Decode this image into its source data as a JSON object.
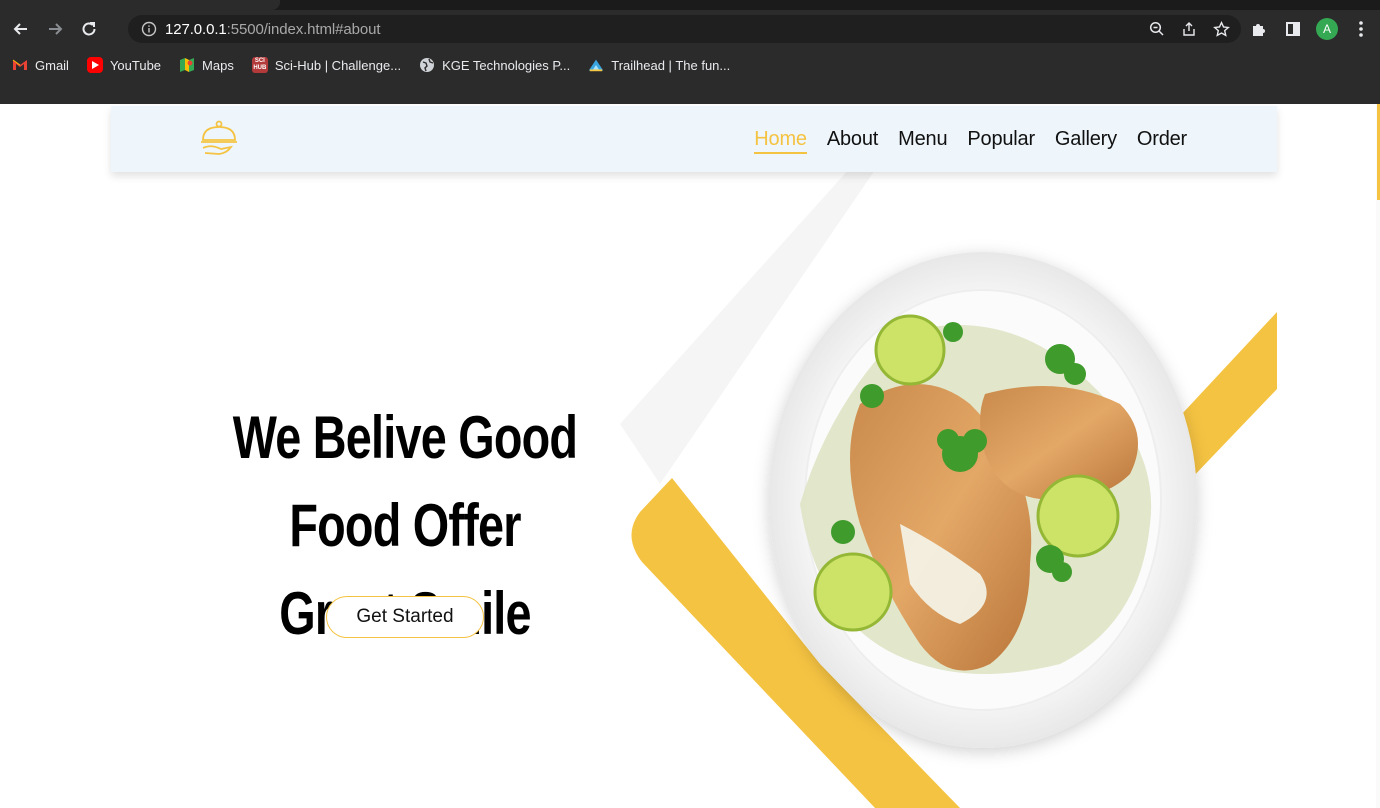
{
  "browser": {
    "url_host": "127.0.0.1",
    "url_rest": ":5500/index.html#about",
    "avatar_letter": "A",
    "bookmarks": [
      {
        "label": "Gmail",
        "icon": "gmail-icon"
      },
      {
        "label": "YouTube",
        "icon": "youtube-icon"
      },
      {
        "label": "Maps",
        "icon": "maps-icon"
      },
      {
        "label": "Sci-Hub | Challenge...",
        "icon": "scihub-icon"
      },
      {
        "label": "KGE Technologies P...",
        "icon": "globe-icon"
      },
      {
        "label": "Trailhead | The fun...",
        "icon": "trailhead-icon"
      }
    ]
  },
  "nav": {
    "items": [
      {
        "label": "Home",
        "active": true
      },
      {
        "label": "About"
      },
      {
        "label": "Menu"
      },
      {
        "label": "Popular"
      },
      {
        "label": "Gallery"
      },
      {
        "label": "Order"
      }
    ]
  },
  "hero": {
    "line1": "We Belive Good Food Offer",
    "line2": "Great Smile",
    "cta": "Get Started"
  },
  "colors": {
    "accent": "#f5c342",
    "navbar_bg": "#eef6fc",
    "chrome_bg": "#2b2b2b"
  }
}
